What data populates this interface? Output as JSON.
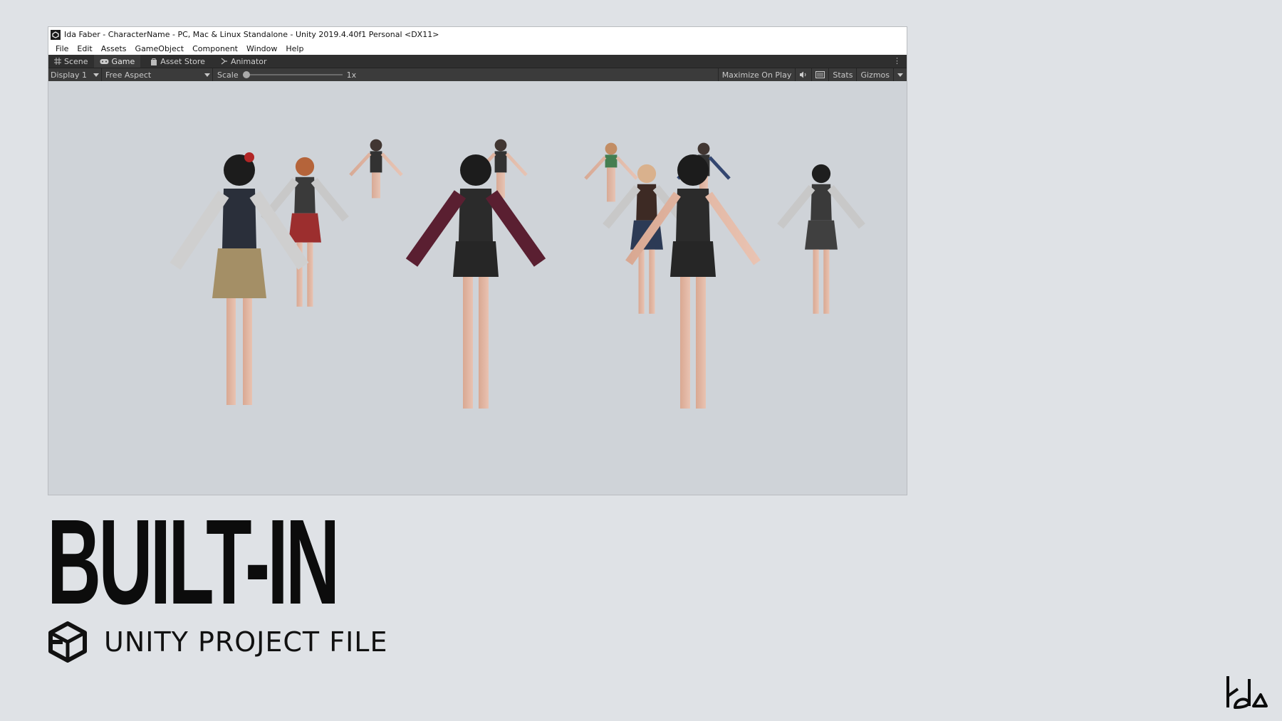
{
  "window": {
    "title": "Ida Faber - CharacterName - PC, Mac & Linux Standalone - Unity 2019.4.40f1 Personal <DX11>",
    "menu": [
      "File",
      "Edit",
      "Assets",
      "GameObject",
      "Component",
      "Window",
      "Help"
    ],
    "tabs": [
      {
        "label": "Scene",
        "icon": "grid-icon"
      },
      {
        "label": "Game",
        "icon": "gamepad-icon"
      },
      {
        "label": "Asset Store",
        "icon": "bag-icon"
      },
      {
        "label": "Animator",
        "icon": "animator-icon"
      }
    ],
    "active_tab": "Game",
    "toolbar": {
      "display": "Display 1",
      "aspect": "Free Aspect",
      "scale_label": "Scale",
      "scale_value": "1x",
      "maximize": "Maximize On Play",
      "stats": "Stats",
      "gizmos": "Gizmos"
    }
  },
  "headline": "BUILT-IN",
  "subtitle": "UNITY PROJECT FILE",
  "colors": {
    "page_bg": "#dfe2e6",
    "viewport_bg": "#cfd3d8",
    "tab_bar": "#2f2f2f",
    "toolbar": "#3b3b3b"
  }
}
